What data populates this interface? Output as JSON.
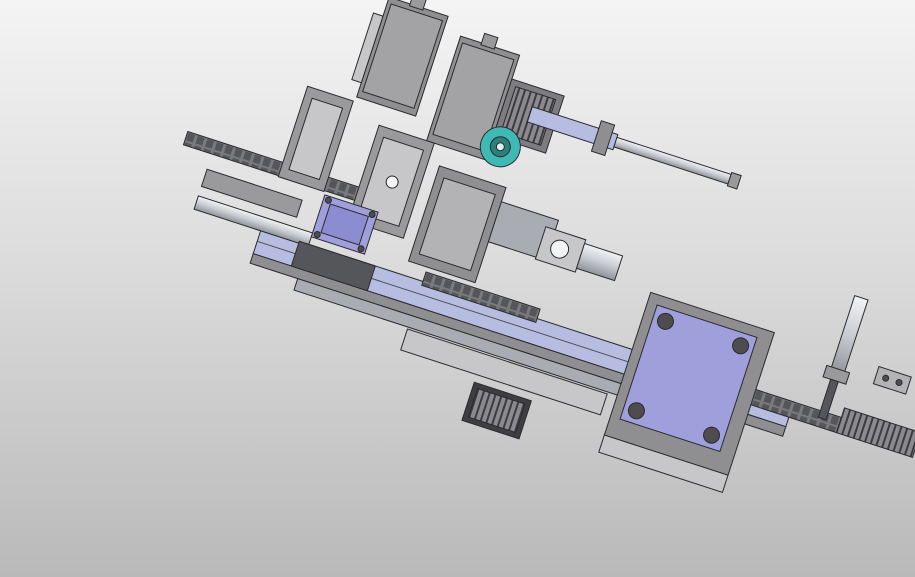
{
  "viewport": {
    "background_top": "#f4f4f4",
    "background_bottom": "#b9b9b9"
  },
  "palette": {
    "body_gray": "#8f8f91",
    "dark_gray": "#4d4d50",
    "light_gray": "#c7c7ca",
    "steel": "#a9acb3",
    "outline": "#2b2b2e",
    "motor_plate": "#9f9fdc",
    "slide_blue": "#b7bde0",
    "accent_cyan": "#3fb9b4",
    "rod": "#d9dbe0"
  },
  "assembly": {
    "name": "automation-machine-assembly",
    "parts": [
      "feeder-module-left",
      "feeder-module-right",
      "vertical-slide-1",
      "vertical-slide-2",
      "vertical-slide-3",
      "motor-plate-small",
      "motor-plate-large",
      "linear-rail-main",
      "pneumatic-cylinder-top",
      "pneumatic-cylinder-right",
      "pneumatic-cylinder-left",
      "stepper-motor-bottom",
      "drag-chain-left",
      "drag-chain-center",
      "drag-chain-right",
      "rotary-actuator",
      "cyan-wheel",
      "mounting-bracket-small"
    ]
  }
}
